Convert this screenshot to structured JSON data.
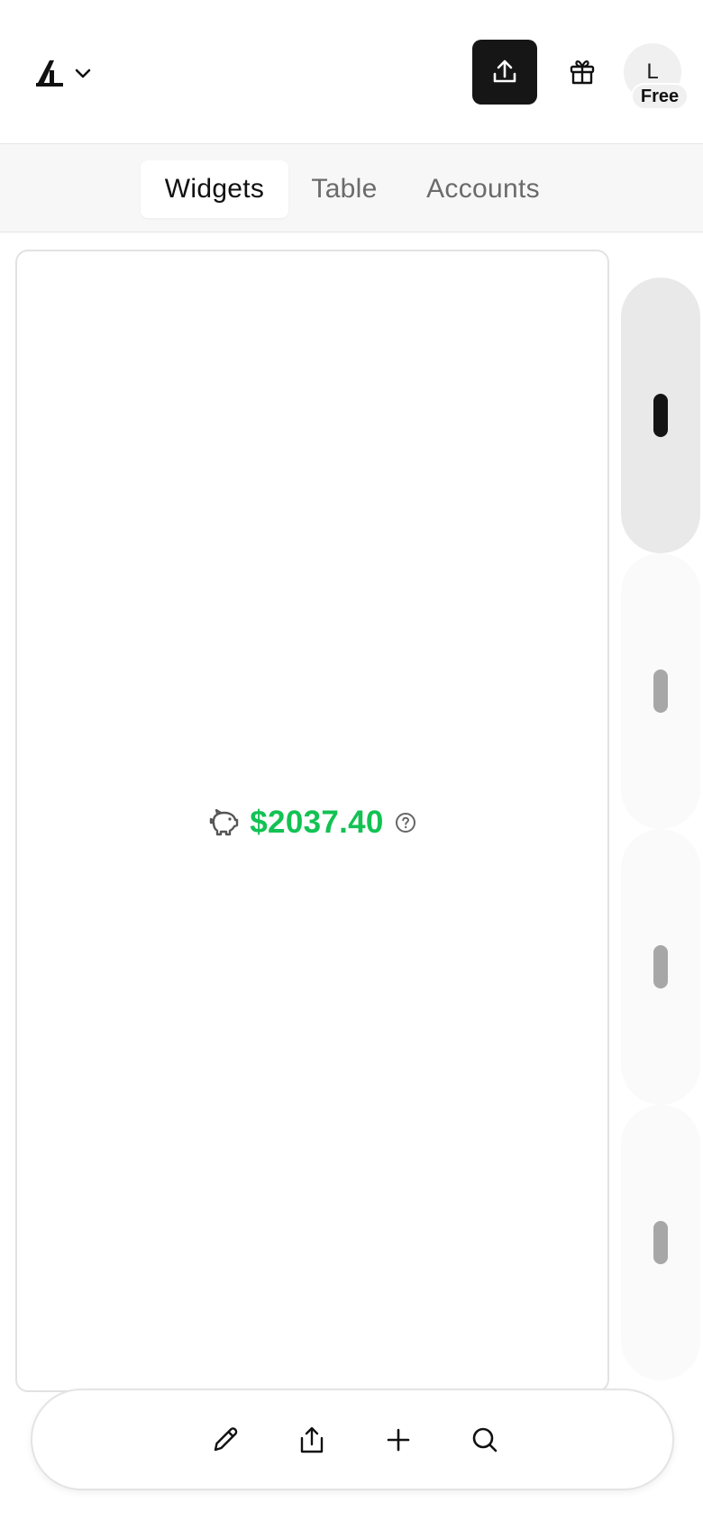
{
  "header": {
    "logo_icon": "lambda-logo-icon",
    "menu_icon": "chevron-down-icon",
    "upload_icon": "upload-icon",
    "gift_icon": "gift-icon",
    "avatar_initial": "L",
    "plan_badge": "Free"
  },
  "tabs": [
    {
      "label": "Widgets",
      "active": true
    },
    {
      "label": "Table",
      "active": false
    },
    {
      "label": "Accounts",
      "active": false
    }
  ],
  "widget": {
    "icon": "piggy-bank-icon",
    "amount": "$2037.40",
    "amount_color": "#12c253",
    "help_icon": "help-circle-icon"
  },
  "pager": {
    "pages": 4,
    "active_page": 1
  },
  "toolbar": {
    "items": [
      {
        "icon": "pencil-icon",
        "action": "edit"
      },
      {
        "icon": "share-icon",
        "action": "share"
      },
      {
        "icon": "plus-icon",
        "action": "add"
      },
      {
        "icon": "search-icon",
        "action": "search"
      }
    ]
  },
  "colors": {
    "accent_dark": "#161616",
    "positive": "#12c253",
    "tab_bar_bg": "#f7f7f7"
  }
}
